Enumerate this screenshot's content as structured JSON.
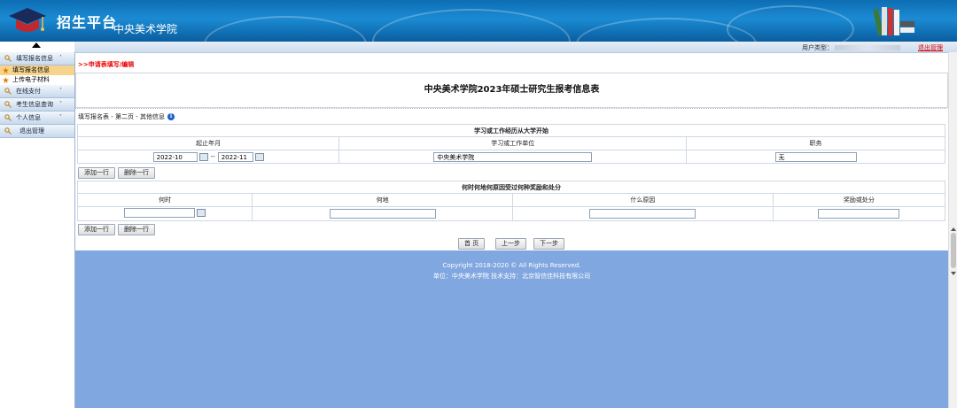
{
  "header": {
    "brand": "招生平台",
    "school": "中央美术学院",
    "logo_icon": "graduation-cap-icon",
    "decor_icon": "books-icon"
  },
  "userbar": {
    "user_type_label": "用户类型：",
    "logout": "退出管理"
  },
  "sidebar": {
    "items": [
      {
        "label": "填写报名信息",
        "chevron": "˄",
        "icon": "key-icon"
      },
      {
        "label": "在线支付",
        "chevron": "˅",
        "icon": "key-icon"
      },
      {
        "label": "考生信息查询",
        "chevron": "˅",
        "icon": "key-icon"
      },
      {
        "label": "个人信息",
        "chevron": "˅",
        "icon": "key-icon"
      },
      {
        "label": "退出管理",
        "chevron": "",
        "icon": "key-icon"
      }
    ],
    "sub_items": [
      {
        "label": "填写报名信息",
        "active": true,
        "icon": "star-icon"
      },
      {
        "label": "上传电子材料",
        "active": false,
        "icon": "star-icon"
      }
    ]
  },
  "main": {
    "breadcrumb": ">>申请表填写/编辑",
    "form_title": "中央美术学院2023年硕士研究生报考信息表",
    "section_head": "填写报名表 - 第二页 - 其他信息",
    "work": {
      "group_title": "学习或工作经历从大学开始",
      "headers": [
        "起止年月",
        "学习或工作单位",
        "职务"
      ],
      "row": {
        "start": "2022-10",
        "sep": "--",
        "end": "2022-11",
        "unit": "中央美术学院",
        "position": "无"
      }
    },
    "awards": {
      "group_title": "何时何地何原因受过何种奖励和处分",
      "headers": [
        "何时",
        "何地",
        "什么原因",
        "奖励或处分"
      ],
      "row": {
        "when": "",
        "where": "",
        "reason": "",
        "result": ""
      }
    },
    "buttons": {
      "add_row": "添加一行",
      "del_row": "删除一行",
      "first": "首 页",
      "prev": "上一步",
      "next": "下一步"
    }
  },
  "footer": {
    "copyright": "Copyright 2018-2020 © All Rights Reserved.",
    "support": "单位：中央美术学院    技术支持：北京智信佳科技有限公司"
  },
  "colors": {
    "header": "#0d6db3",
    "footer": "#81a7e0",
    "breadcrumb": "#e00000",
    "active_menu": "#f7d48b"
  }
}
